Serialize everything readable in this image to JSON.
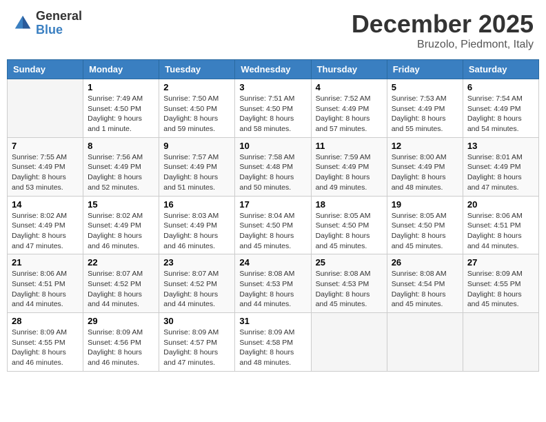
{
  "header": {
    "logo_general": "General",
    "logo_blue": "Blue",
    "month_title": "December 2025",
    "location": "Bruzolo, Piedmont, Italy"
  },
  "days_of_week": [
    "Sunday",
    "Monday",
    "Tuesday",
    "Wednesday",
    "Thursday",
    "Friday",
    "Saturday"
  ],
  "weeks": [
    [
      {
        "day": "",
        "sunrise": "",
        "sunset": "",
        "daylight": ""
      },
      {
        "day": "1",
        "sunrise": "Sunrise: 7:49 AM",
        "sunset": "Sunset: 4:50 PM",
        "daylight": "Daylight: 9 hours and 1 minute."
      },
      {
        "day": "2",
        "sunrise": "Sunrise: 7:50 AM",
        "sunset": "Sunset: 4:50 PM",
        "daylight": "Daylight: 8 hours and 59 minutes."
      },
      {
        "day": "3",
        "sunrise": "Sunrise: 7:51 AM",
        "sunset": "Sunset: 4:50 PM",
        "daylight": "Daylight: 8 hours and 58 minutes."
      },
      {
        "day": "4",
        "sunrise": "Sunrise: 7:52 AM",
        "sunset": "Sunset: 4:49 PM",
        "daylight": "Daylight: 8 hours and 57 minutes."
      },
      {
        "day": "5",
        "sunrise": "Sunrise: 7:53 AM",
        "sunset": "Sunset: 4:49 PM",
        "daylight": "Daylight: 8 hours and 55 minutes."
      },
      {
        "day": "6",
        "sunrise": "Sunrise: 7:54 AM",
        "sunset": "Sunset: 4:49 PM",
        "daylight": "Daylight: 8 hours and 54 minutes."
      }
    ],
    [
      {
        "day": "7",
        "sunrise": "Sunrise: 7:55 AM",
        "sunset": "Sunset: 4:49 PM",
        "daylight": "Daylight: 8 hours and 53 minutes."
      },
      {
        "day": "8",
        "sunrise": "Sunrise: 7:56 AM",
        "sunset": "Sunset: 4:49 PM",
        "daylight": "Daylight: 8 hours and 52 minutes."
      },
      {
        "day": "9",
        "sunrise": "Sunrise: 7:57 AM",
        "sunset": "Sunset: 4:49 PM",
        "daylight": "Daylight: 8 hours and 51 minutes."
      },
      {
        "day": "10",
        "sunrise": "Sunrise: 7:58 AM",
        "sunset": "Sunset: 4:48 PM",
        "daylight": "Daylight: 8 hours and 50 minutes."
      },
      {
        "day": "11",
        "sunrise": "Sunrise: 7:59 AM",
        "sunset": "Sunset: 4:49 PM",
        "daylight": "Daylight: 8 hours and 49 minutes."
      },
      {
        "day": "12",
        "sunrise": "Sunrise: 8:00 AM",
        "sunset": "Sunset: 4:49 PM",
        "daylight": "Daylight: 8 hours and 48 minutes."
      },
      {
        "day": "13",
        "sunrise": "Sunrise: 8:01 AM",
        "sunset": "Sunset: 4:49 PM",
        "daylight": "Daylight: 8 hours and 47 minutes."
      }
    ],
    [
      {
        "day": "14",
        "sunrise": "Sunrise: 8:02 AM",
        "sunset": "Sunset: 4:49 PM",
        "daylight": "Daylight: 8 hours and 47 minutes."
      },
      {
        "day": "15",
        "sunrise": "Sunrise: 8:02 AM",
        "sunset": "Sunset: 4:49 PM",
        "daylight": "Daylight: 8 hours and 46 minutes."
      },
      {
        "day": "16",
        "sunrise": "Sunrise: 8:03 AM",
        "sunset": "Sunset: 4:49 PM",
        "daylight": "Daylight: 8 hours and 46 minutes."
      },
      {
        "day": "17",
        "sunrise": "Sunrise: 8:04 AM",
        "sunset": "Sunset: 4:50 PM",
        "daylight": "Daylight: 8 hours and 45 minutes."
      },
      {
        "day": "18",
        "sunrise": "Sunrise: 8:05 AM",
        "sunset": "Sunset: 4:50 PM",
        "daylight": "Daylight: 8 hours and 45 minutes."
      },
      {
        "day": "19",
        "sunrise": "Sunrise: 8:05 AM",
        "sunset": "Sunset: 4:50 PM",
        "daylight": "Daylight: 8 hours and 45 minutes."
      },
      {
        "day": "20",
        "sunrise": "Sunrise: 8:06 AM",
        "sunset": "Sunset: 4:51 PM",
        "daylight": "Daylight: 8 hours and 44 minutes."
      }
    ],
    [
      {
        "day": "21",
        "sunrise": "Sunrise: 8:06 AM",
        "sunset": "Sunset: 4:51 PM",
        "daylight": "Daylight: 8 hours and 44 minutes."
      },
      {
        "day": "22",
        "sunrise": "Sunrise: 8:07 AM",
        "sunset": "Sunset: 4:52 PM",
        "daylight": "Daylight: 8 hours and 44 minutes."
      },
      {
        "day": "23",
        "sunrise": "Sunrise: 8:07 AM",
        "sunset": "Sunset: 4:52 PM",
        "daylight": "Daylight: 8 hours and 44 minutes."
      },
      {
        "day": "24",
        "sunrise": "Sunrise: 8:08 AM",
        "sunset": "Sunset: 4:53 PM",
        "daylight": "Daylight: 8 hours and 44 minutes."
      },
      {
        "day": "25",
        "sunrise": "Sunrise: 8:08 AM",
        "sunset": "Sunset: 4:53 PM",
        "daylight": "Daylight: 8 hours and 45 minutes."
      },
      {
        "day": "26",
        "sunrise": "Sunrise: 8:08 AM",
        "sunset": "Sunset: 4:54 PM",
        "daylight": "Daylight: 8 hours and 45 minutes."
      },
      {
        "day": "27",
        "sunrise": "Sunrise: 8:09 AM",
        "sunset": "Sunset: 4:55 PM",
        "daylight": "Daylight: 8 hours and 45 minutes."
      }
    ],
    [
      {
        "day": "28",
        "sunrise": "Sunrise: 8:09 AM",
        "sunset": "Sunset: 4:55 PM",
        "daylight": "Daylight: 8 hours and 46 minutes."
      },
      {
        "day": "29",
        "sunrise": "Sunrise: 8:09 AM",
        "sunset": "Sunset: 4:56 PM",
        "daylight": "Daylight: 8 hours and 46 minutes."
      },
      {
        "day": "30",
        "sunrise": "Sunrise: 8:09 AM",
        "sunset": "Sunset: 4:57 PM",
        "daylight": "Daylight: 8 hours and 47 minutes."
      },
      {
        "day": "31",
        "sunrise": "Sunrise: 8:09 AM",
        "sunset": "Sunset: 4:58 PM",
        "daylight": "Daylight: 8 hours and 48 minutes."
      },
      {
        "day": "",
        "sunrise": "",
        "sunset": "",
        "daylight": ""
      },
      {
        "day": "",
        "sunrise": "",
        "sunset": "",
        "daylight": ""
      },
      {
        "day": "",
        "sunrise": "",
        "sunset": "",
        "daylight": ""
      }
    ]
  ]
}
